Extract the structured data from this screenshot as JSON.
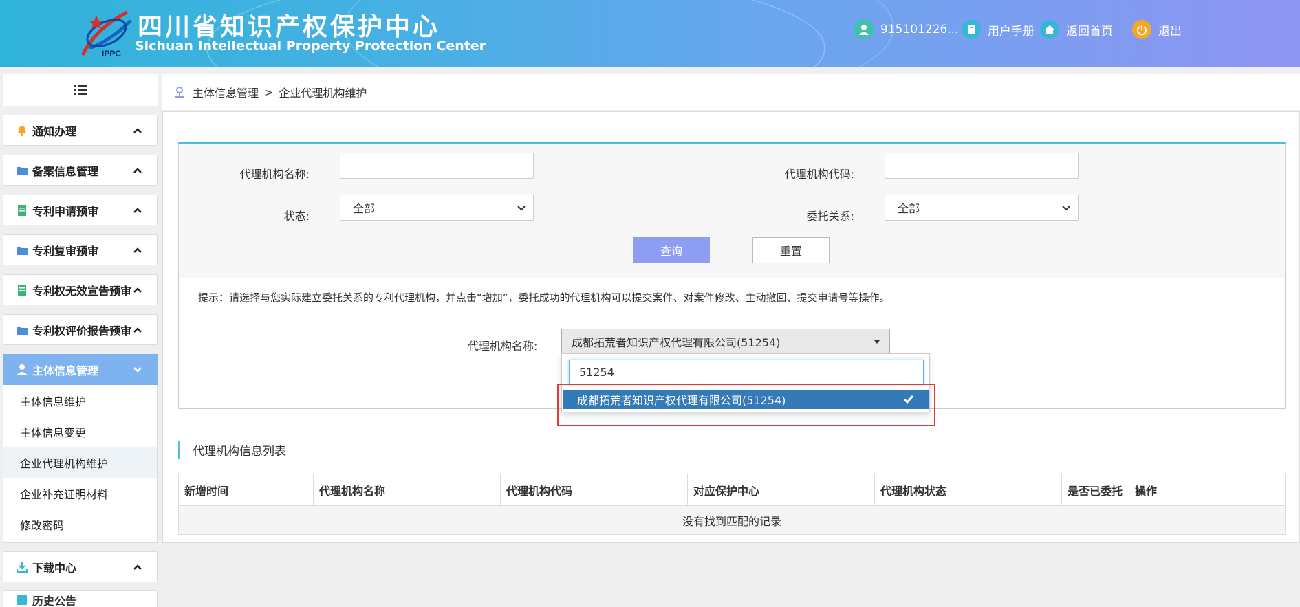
{
  "header": {
    "title_cn": "四川省知识产权保护中心",
    "title_en": "Sichuan Intellectual Property Protection Center",
    "logo_text": "IPPC",
    "user_id": "915101226...",
    "manual_label": "用户手册",
    "home_label": "返回首页",
    "logout_label": "退出"
  },
  "sidebar": {
    "items": [
      {
        "label": "通知办理"
      },
      {
        "label": "备案信息管理"
      },
      {
        "label": "专利申请预审"
      },
      {
        "label": "专利复审预审"
      },
      {
        "label": "专利权无效宣告预审"
      },
      {
        "label": "专利权评价报告预审"
      },
      {
        "label": "主体信息管理"
      }
    ],
    "sub_items": [
      {
        "label": "主体信息维护"
      },
      {
        "label": "主体信息变更"
      },
      {
        "label": "企业代理机构维护"
      },
      {
        "label": "企业补充证明材料"
      },
      {
        "label": "修改密码"
      }
    ],
    "download_label": "下载中心",
    "history_label": "历史公告"
  },
  "breadcrumb": {
    "root": "主体信息管理",
    "separator": ">",
    "current": "企业代理机构维护"
  },
  "search": {
    "name_label": "代理机构名称:",
    "name_value": "",
    "code_label": "代理机构代码:",
    "code_value": "",
    "status_label": "状态:",
    "status_value": "全部",
    "relation_label": "委托关系:",
    "relation_value": "全部",
    "query_button": "查询",
    "reset_button": "重置"
  },
  "tip": "提示：请选择与您实际建立委托关系的专利代理机构，并点击“增加”，委托成功的代理机构可以提交案件、对案件修改、主动撤回、提交申请号等操作。",
  "agent": {
    "label": "代理机构名称:",
    "selected": "成都拓荒者知识产权代理有限公司(51254)",
    "search_text": "51254",
    "option": "成都拓荒者知识产权代理有限公司(51254)"
  },
  "list": {
    "title": "代理机构信息列表",
    "columns": [
      "新增时间",
      "代理机构名称",
      "代理机构代码",
      "对应保护中心",
      "代理机构状态",
      "是否已委托",
      "操作"
    ],
    "empty_text": "没有找到匹配的记录"
  },
  "colors": {
    "accent": "#52bbe2",
    "primary_button": "#8c9df2",
    "selected_option": "#337ab7",
    "highlight_frame": "#e53935"
  }
}
